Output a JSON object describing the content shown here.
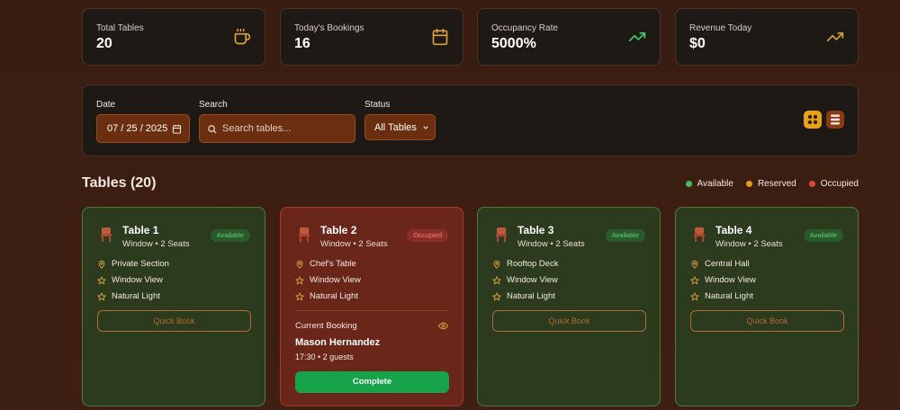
{
  "stats": [
    {
      "label": "Total Tables",
      "value": "20",
      "icon": "coffee-icon",
      "color": "#d9a23b"
    },
    {
      "label": "Today's Bookings",
      "value": "16",
      "icon": "calendar-icon",
      "color": "#d9a23b"
    },
    {
      "label": "Occupancy Rate",
      "value": "5000%",
      "icon": "trending-up-icon",
      "color": "#3fcf6f"
    },
    {
      "label": "Revenue Today",
      "value": "$0",
      "icon": "trending-up-icon",
      "color": "#d9a23b"
    }
  ],
  "filters": {
    "date_label": "Date",
    "date_value": "07 / 25 / 2025",
    "search_label": "Search",
    "search_placeholder": "Search tables...",
    "status_label": "Status",
    "status_value": "All Tables"
  },
  "section": {
    "title": "Tables (20)"
  },
  "legend": [
    {
      "label": "Available",
      "color": "#3fbf5a"
    },
    {
      "label": "Reserved",
      "color": "#e69a1f"
    },
    {
      "label": "Occupied",
      "color": "#e0463a"
    }
  ],
  "tables": [
    {
      "name": "Table 1",
      "subtitle": "Window • 2 Seats",
      "status": "Available",
      "features": [
        "Private Section",
        "Window View",
        "Natural Light"
      ],
      "action": "Quick Book"
    },
    {
      "name": "Table 2",
      "subtitle": "Window • 2 Seats",
      "status": "Occupied",
      "features": [
        "Chef's Table",
        "Window View",
        "Natural Light"
      ],
      "booking": {
        "label": "Current Booking",
        "guest": "Mason Hernandez",
        "details": "17:30 • 2 guests",
        "action": "Complete"
      }
    },
    {
      "name": "Table 3",
      "subtitle": "Window • 2 Seats",
      "status": "Available",
      "features": [
        "Rooftop Deck",
        "Window View",
        "Natural Light"
      ],
      "action": "Quick Book"
    },
    {
      "name": "Table 4",
      "subtitle": "Window • 2 Seats",
      "status": "Available",
      "features": [
        "Central Hall",
        "Window View",
        "Natural Light"
      ],
      "action": "Quick Book"
    }
  ]
}
